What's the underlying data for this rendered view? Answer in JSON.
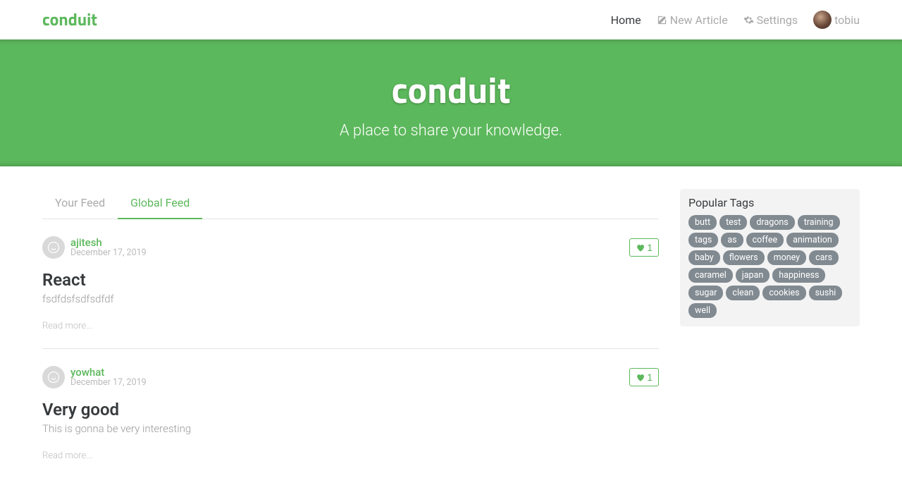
{
  "header": {
    "brand": "conduit",
    "nav": {
      "home": "Home",
      "new_article": "New Article",
      "settings": "Settings",
      "username": "tobiu"
    }
  },
  "banner": {
    "title": "conduit",
    "subtitle": "A place to share your knowledge."
  },
  "feed": {
    "tabs": {
      "your": "Your Feed",
      "global": "Global Feed"
    },
    "active_tab": "global"
  },
  "articles": [
    {
      "author": "ajitesh",
      "date": "December 17, 2019",
      "title": "React",
      "description": "fsdfdsfsdfsdfdf",
      "favorites": "1",
      "read_more": "Read more..."
    },
    {
      "author": "yowhat",
      "date": "December 17, 2019",
      "title": "Very good",
      "description": "This is gonna be very interesting",
      "favorites": "1",
      "read_more": "Read more..."
    }
  ],
  "sidebar": {
    "title": "Popular Tags",
    "tags": [
      "butt",
      "test",
      "dragons",
      "training",
      "tags",
      "as",
      "coffee",
      "animation",
      "baby",
      "flowers",
      "money",
      "cars",
      "caramel",
      "japan",
      "happiness",
      "sugar",
      "clean",
      "cookies",
      "sushi",
      "well"
    ]
  }
}
